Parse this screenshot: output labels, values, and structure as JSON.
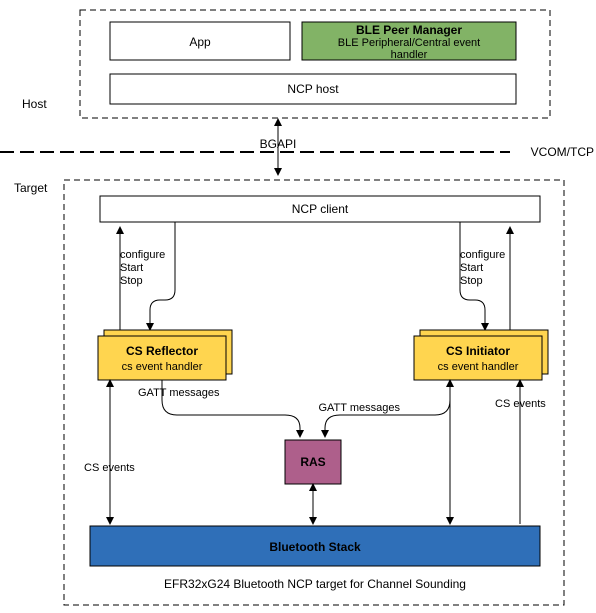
{
  "labels": {
    "host": "Host",
    "target": "Target",
    "app": "App",
    "ble_peer_mgr": "BLE Peer Manager",
    "ble_peer_sub": "BLE Peripheral/Central event",
    "ble_peer_sub2": "handler",
    "ncp_host": "NCP host",
    "bgapi": "BGAPI",
    "vcom": "VCOM/TCP",
    "ncp_client": "NCP client",
    "cfg1": "configure",
    "start1": "Start",
    "stop1": "Stop",
    "cfg2": "configure",
    "start2": "Start",
    "stop2": "Stop",
    "cs_reflector": "CS Reflector",
    "cs_reflector_sub": "cs event handler",
    "cs_initiator": "CS Initiator",
    "cs_initiator_sub": "cs event handler",
    "gatt1": "GATT messages",
    "gatt2": "GATT messages",
    "cs_events1": "CS events",
    "cs_events2": "CS events",
    "ras": "RAS",
    "bt_stack": "Bluetooth Stack",
    "footer": "EFR32xG24 Bluetooth NCP target for Channel Sounding"
  }
}
